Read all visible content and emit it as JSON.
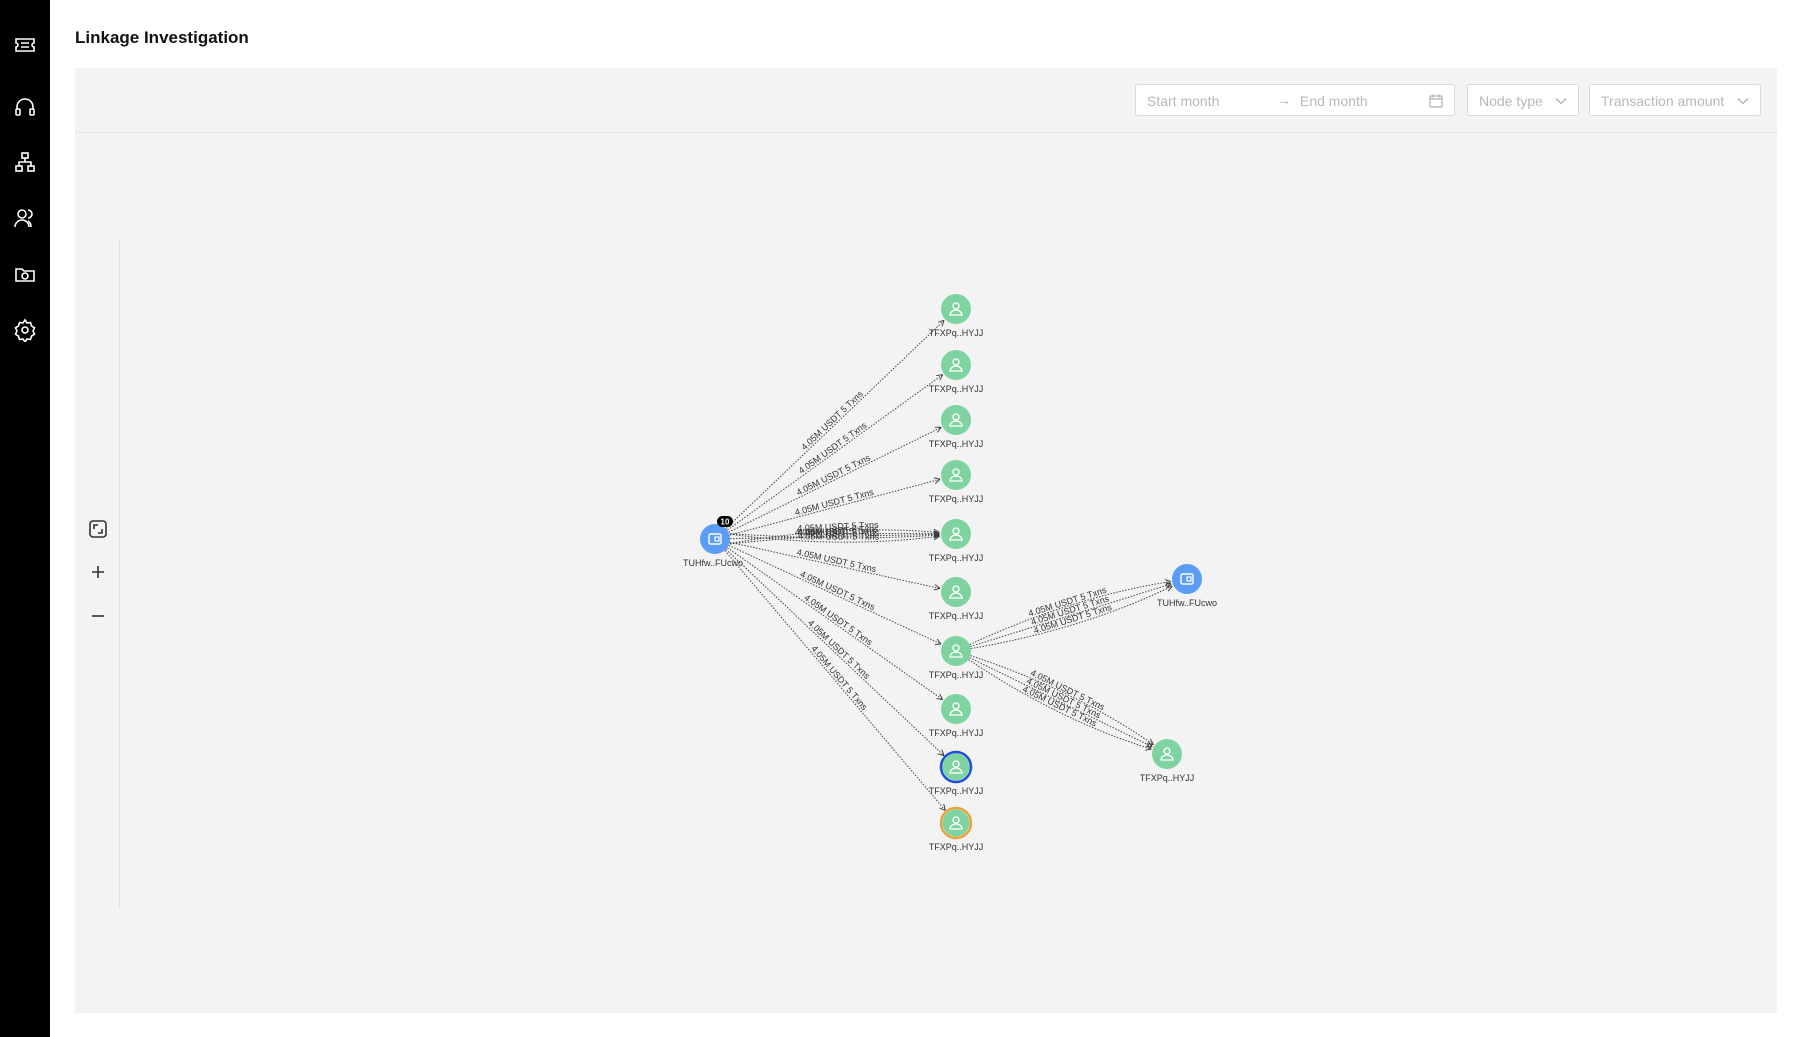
{
  "page": {
    "title": "Linkage Investigation"
  },
  "nav": {
    "items": [
      {
        "icon": "ticket-icon"
      },
      {
        "icon": "headset-icon"
      },
      {
        "icon": "hierarchy-icon"
      },
      {
        "icon": "users-icon"
      },
      {
        "icon": "camera-folder-icon"
      },
      {
        "icon": "gear-icon"
      }
    ]
  },
  "filters": {
    "start_placeholder": "Start month",
    "range_separator": "→",
    "end_placeholder": "End month",
    "node_type_placeholder": "Node type",
    "amount_placeholder": "Transaction amount"
  },
  "controls": [
    "fit-view-icon",
    "zoom-in-icon",
    "zoom-out-icon"
  ],
  "graph": {
    "edge_label": "4.05M USDT 5 Txns",
    "source": {
      "label": "TUHfw..FUcwo",
      "badge": "10",
      "type": "wallet",
      "color": "#5b9cf5"
    },
    "targets": [
      {
        "label": "TFXPq..HYJJ",
        "type": "user",
        "color": "#7fd3a0",
        "ring": ""
      },
      {
        "label": "TFXPq..HYJJ",
        "type": "user",
        "color": "#7fd3a0",
        "ring": ""
      },
      {
        "label": "TFXPq..HYJJ",
        "type": "user",
        "color": "#7fd3a0",
        "ring": ""
      },
      {
        "label": "TFXPq..HYJJ",
        "type": "user",
        "color": "#7fd3a0",
        "ring": ""
      },
      {
        "label": "TFXPq..HYJJ",
        "type": "user",
        "color": "#7fd3a0",
        "ring": ""
      },
      {
        "label": "TFXPq..HYJJ",
        "type": "user",
        "color": "#7fd3a0",
        "ring": ""
      },
      {
        "label": "TFXPq..HYJJ",
        "type": "user",
        "color": "#7fd3a0",
        "ring": ""
      },
      {
        "label": "TFXPq..HYJJ",
        "type": "user",
        "color": "#7fd3a0",
        "ring": ""
      },
      {
        "label": "TFXPq..HYJJ",
        "type": "user",
        "color": "#7fd3a0",
        "ring": "#1d4fd8"
      },
      {
        "label": "TFXPq..HYJJ",
        "type": "user",
        "color": "#7fd3a0",
        "ring": "#e8a33d"
      }
    ],
    "second_level": [
      {
        "label": "TUHfw..FUcwo",
        "type": "wallet",
        "color": "#5b9cf5"
      },
      {
        "label": "TFXPq..HYJJ",
        "type": "user",
        "color": "#7fd3a0"
      }
    ]
  }
}
